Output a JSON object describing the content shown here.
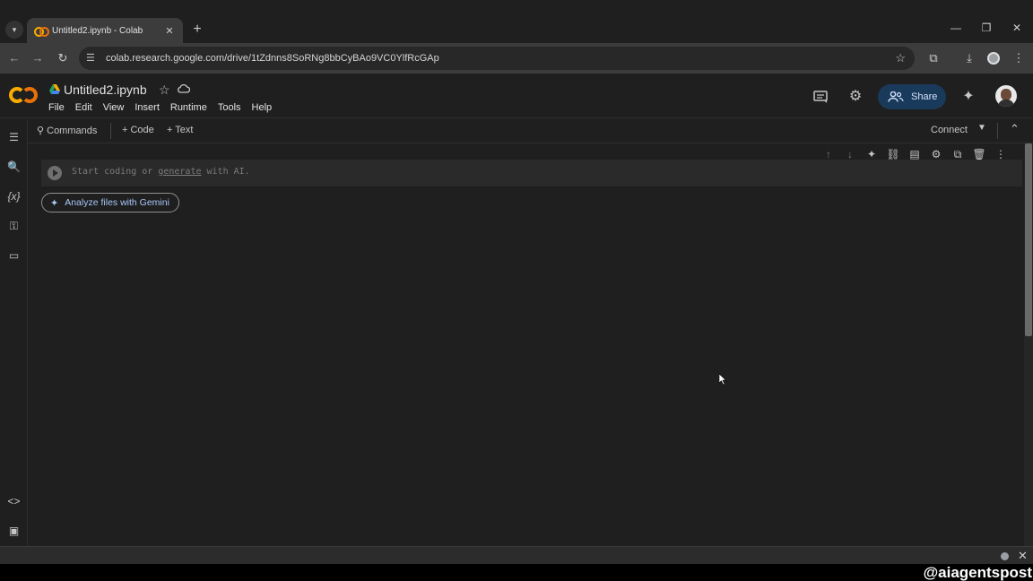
{
  "browser": {
    "tab_title": "Untitled2.ipynb - Colab",
    "tab_close": "✕",
    "new_tab": "+",
    "url": "colab.research.google.com/drive/1tZdnns8SoRNg8bbCyBAo9VC0YlfRcGAp"
  },
  "notebook": {
    "title": "Untitled2.ipynb"
  },
  "menu": [
    "File",
    "Edit",
    "View",
    "Insert",
    "Runtime",
    "Tools",
    "Help"
  ],
  "header": {
    "share_label": "Share"
  },
  "toolbar": {
    "commands_label": "Commands",
    "code_label": "+ Code",
    "text_label": "+ Text",
    "connect_label": "Connect"
  },
  "cell": {
    "placeholder_pre": "Start coding or ",
    "placeholder_link": "generate",
    "placeholder_post": " with AI."
  },
  "gemini_button": {
    "label": "Analyze files with Gemini"
  },
  "watermark": "@aiagentspost",
  "icons": {
    "tab_menu": "chevron-down-icon",
    "back": "arrow-left-icon",
    "forward": "arrow-right-icon",
    "reload": "reload-icon",
    "site_info": "tune-icon",
    "bookmark": "star-icon",
    "extensions": "puzzle-icon",
    "downloads": "download-icon",
    "profile": "profile-icon",
    "browser_menu": "more-vert-icon"
  },
  "colors": {
    "accent_orange": "#f9ab00",
    "accent_orange2": "#e8710a",
    "share_bg": "#1a3a5c",
    "gemini_blue": "#a8c7fa"
  }
}
